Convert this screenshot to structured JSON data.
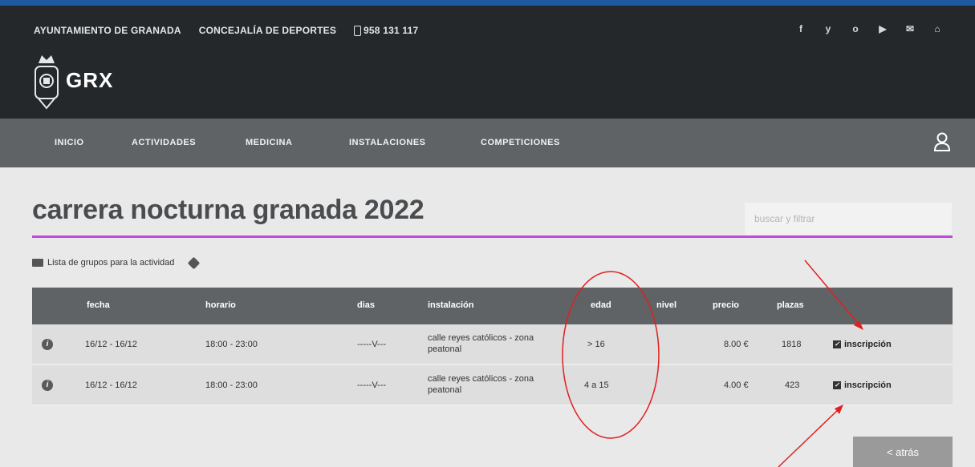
{
  "topbar": {
    "ayuntamiento": "AYUNTAMIENTO DE GRANADA",
    "concejalia": "CONCEJALÍA DE DEPORTES",
    "phone": "958 131 117",
    "social": [
      "f",
      "y",
      "o",
      "▶",
      "✉",
      "⌂"
    ]
  },
  "brand": {
    "logo_text": "GRX"
  },
  "nav": {
    "items": [
      "INICIO",
      "ACTIVIDADES",
      "MEDICINA",
      "INSTALACIONES",
      "COMPETICIONES"
    ]
  },
  "page": {
    "title": "carrera nocturna granada 2022",
    "search_placeholder": "buscar y filtrar",
    "group_label": "Lista de grupos para la actividad"
  },
  "table": {
    "headers": [
      "fecha",
      "horario",
      "dias",
      "instalación",
      "edad",
      "nivel",
      "precio",
      "plazas"
    ],
    "rows": [
      {
        "fecha": "16/12 - 16/12",
        "horario": "18:00 - 23:00",
        "dias": "-----V---",
        "instalacion": "calle reyes católicos - zona peatonal",
        "edad": "> 16",
        "nivel": "",
        "precio": "8.00 €",
        "plazas": "1818",
        "accion": "inscripción"
      },
      {
        "fecha": "16/12 - 16/12",
        "horario": "18:00 - 23:00",
        "dias": "-----V---",
        "instalacion": "calle reyes católicos - zona peatonal",
        "edad": "4 a 15",
        "nivel": "",
        "precio": "4.00 €",
        "plazas": "423",
        "accion": "inscripción"
      }
    ]
  },
  "back_button": "< atrás",
  "colors": {
    "accent_line": "#c24ad8",
    "annotation": "#e02020"
  }
}
